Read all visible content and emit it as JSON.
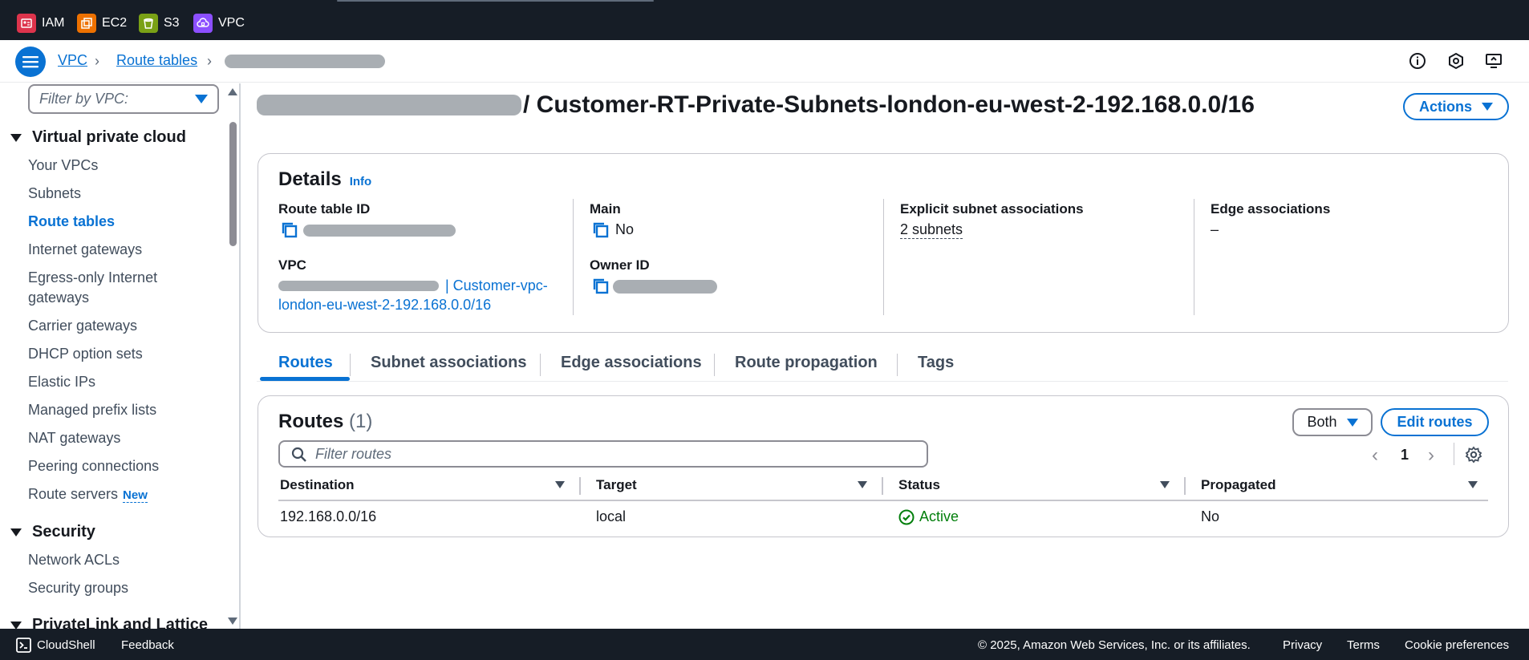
{
  "favorites": [
    {
      "label": "IAM",
      "color": "#dd344c"
    },
    {
      "label": "EC2",
      "color": "#ed7100"
    },
    {
      "label": "S3",
      "color": "#7aa116"
    },
    {
      "label": "VPC",
      "color": "#8c4fff"
    }
  ],
  "breadcrumb": {
    "vpc": "VPC",
    "route_tables": "Route tables"
  },
  "sidebar": {
    "filter_placeholder": "Filter by VPC:",
    "section_vpc": "Virtual private cloud",
    "items": [
      "Your VPCs",
      "Subnets",
      "Route tables",
      "Internet gateways",
      "Egress-only Internet gateways",
      "Carrier gateways",
      "DHCP option sets",
      "Elastic IPs",
      "Managed prefix lists",
      "NAT gateways",
      "Peering connections",
      "Route servers"
    ],
    "new_badge": "New",
    "section_security": "Security",
    "security_items": [
      "Network ACLs",
      "Security groups"
    ],
    "section_privatelink": "PrivateLink and Lattice"
  },
  "page": {
    "title": "/ Customer-RT-Private-Subnets-london-eu-west-2-192.168.0.0/16",
    "actions_label": "Actions"
  },
  "details": {
    "title": "Details",
    "info": "Info",
    "route_table_id_label": "Route table ID",
    "main_label": "Main",
    "main_value": "No",
    "explicit_label": "Explicit subnet associations",
    "explicit_value": "2 subnets",
    "edge_label": "Edge associations",
    "edge_value": "–",
    "vpc_label": "VPC",
    "vpc_value_line1": "| Customer-vpc-",
    "vpc_value_line2": "london-eu-west-2-192.168.0.0/16",
    "owner_label": "Owner ID"
  },
  "tabs": [
    "Routes",
    "Subnet associations",
    "Edge associations",
    "Route propagation",
    "Tags"
  ],
  "routes": {
    "title": "Routes",
    "count": "(1)",
    "filter_label": "Both",
    "edit_label": "Edit routes",
    "search_placeholder": "Filter routes",
    "page": "1",
    "columns": [
      "Destination",
      "Target",
      "Status",
      "Propagated"
    ],
    "rows": [
      {
        "destination": "192.168.0.0/16",
        "target": "local",
        "status": "Active",
        "propagated": "No"
      }
    ]
  },
  "footer": {
    "cloudshell": "CloudShell",
    "feedback": "Feedback",
    "copyright": "© 2025, Amazon Web Services, Inc. or its affiliates.",
    "privacy": "Privacy",
    "terms": "Terms",
    "cookies": "Cookie preferences"
  },
  "colors": {
    "accent": "#0972d3",
    "success": "#037f0c",
    "nav_bg": "#161d26"
  }
}
